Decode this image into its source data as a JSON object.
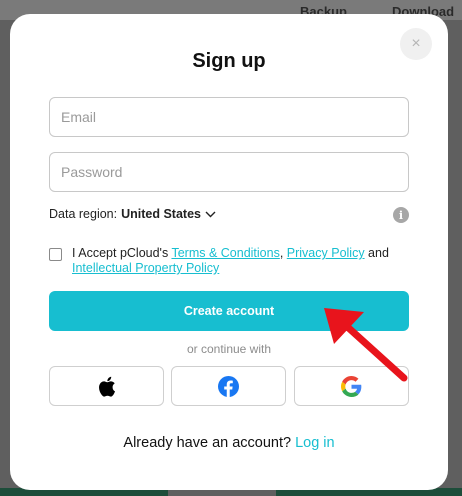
{
  "background": {
    "nav": [
      "Backup",
      "Download"
    ]
  },
  "modal": {
    "title": "Sign up",
    "close_label": "×",
    "email_placeholder": "Email",
    "password_placeholder": "Password",
    "region_label": "Data region:",
    "region_value": "United States",
    "info_label": "i",
    "accept": {
      "prefix": "I Accept pCloud's ",
      "terms": "Terms & Conditions",
      "comma": ", ",
      "privacy": "Privacy Policy",
      "and": " and",
      "ip": "Intellectual Property Policy"
    },
    "create_label": "Create account",
    "or_text": "or continue with",
    "already_text": "Already have an account?",
    "login_label": "Log in"
  },
  "colors": {
    "accent": "#17bed0",
    "facebook": "#1877f2",
    "annotation_red": "#e8141c"
  },
  "icons": [
    "close-icon",
    "chevron-down-icon",
    "info-icon",
    "apple-icon",
    "facebook-icon",
    "google-icon"
  ]
}
